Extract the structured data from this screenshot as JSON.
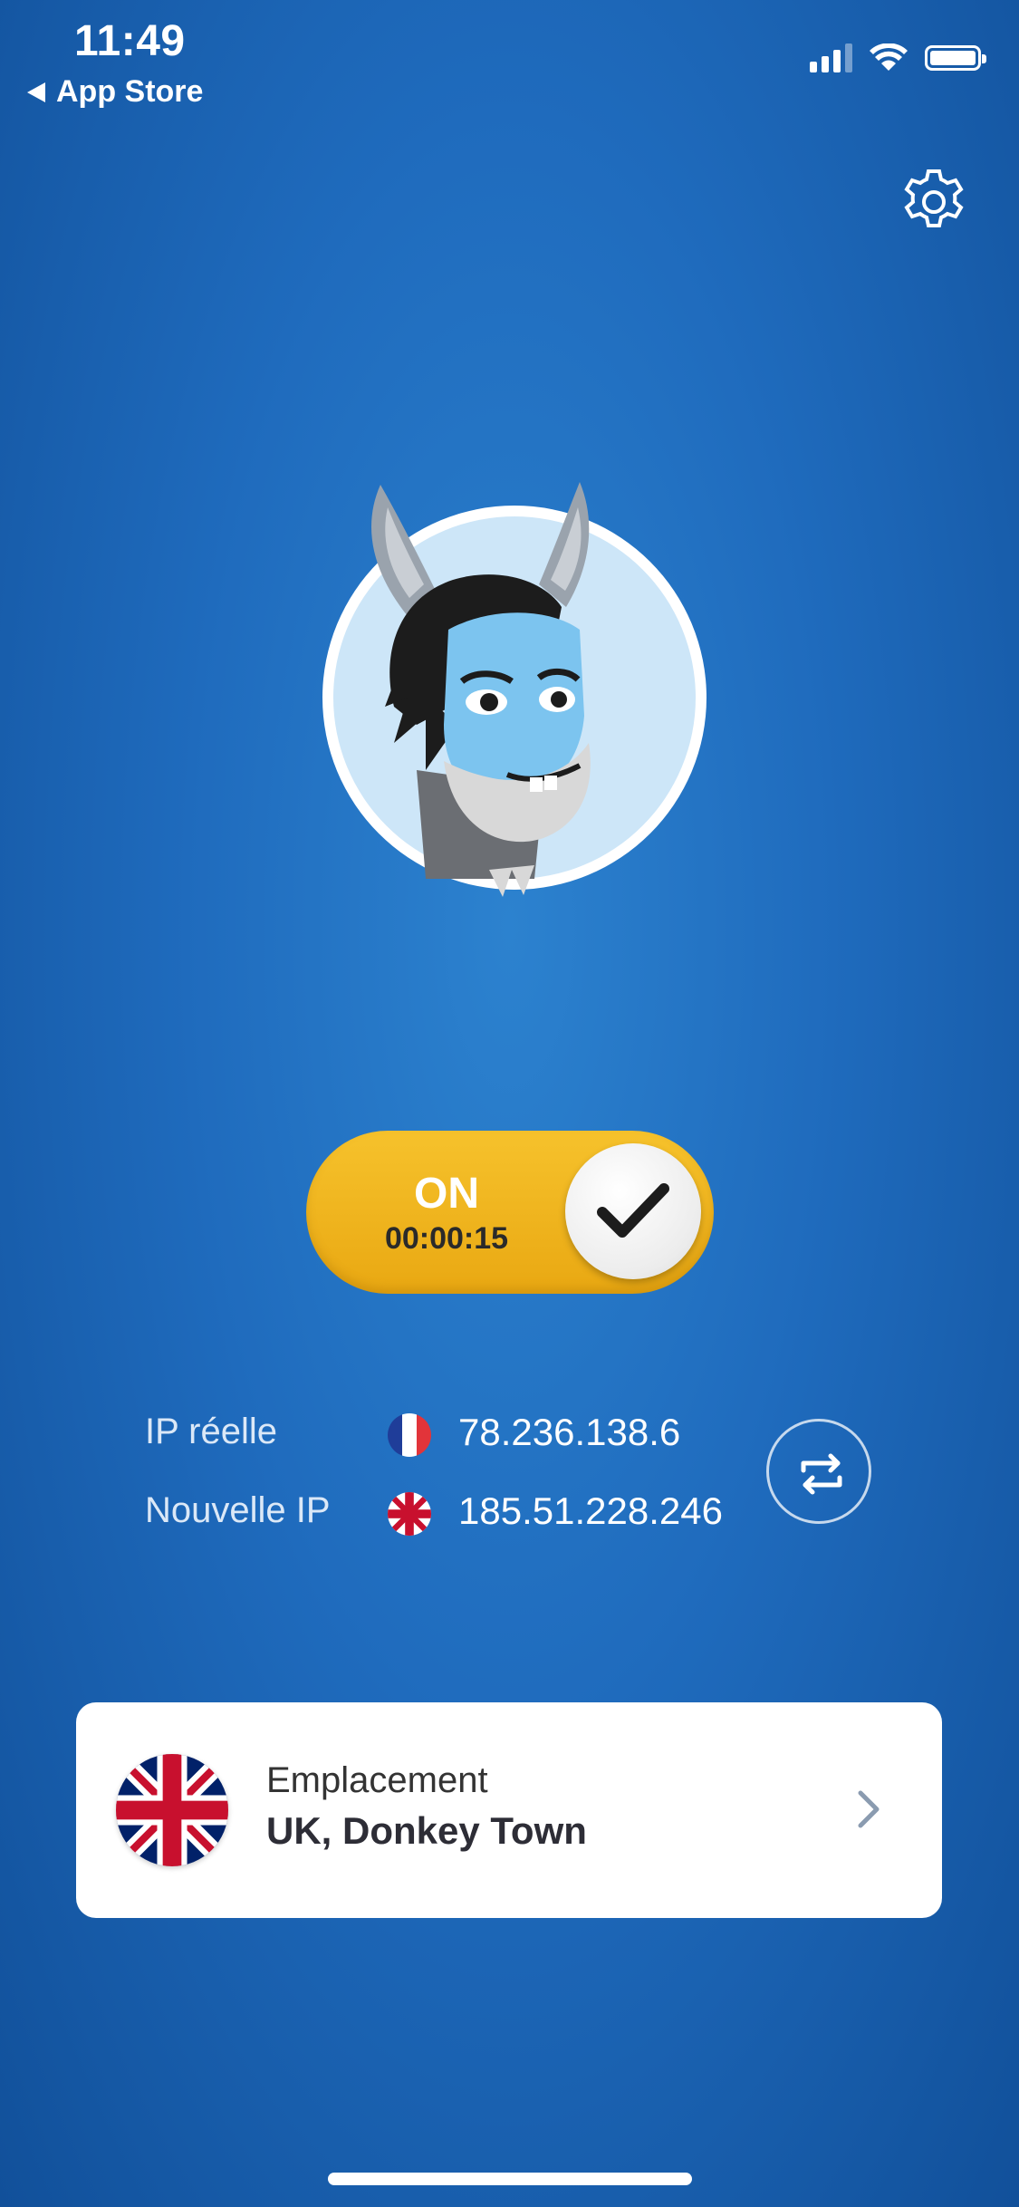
{
  "status_bar": {
    "time": "11:49",
    "back_label": "App Store"
  },
  "settings": {
    "icon": "gear-icon"
  },
  "avatar": {
    "icon": "donkey-mascot-icon"
  },
  "toggle": {
    "state_label": "ON",
    "timer": "00:00:15",
    "icon": "checkmark-icon"
  },
  "ip": {
    "real_label": "IP réelle",
    "real_value": "78.236.138.6",
    "real_flag": "france-flag-icon",
    "new_label": "Nouvelle IP",
    "new_value": "185.51.228.246",
    "new_flag": "uk-flag-icon",
    "swap_icon": "swap-icon"
  },
  "location": {
    "label": "Emplacement",
    "value": "UK, Donkey Town",
    "flag": "uk-flag-icon"
  },
  "colors": {
    "background": "#1f6bbd",
    "toggle": "#f2b822",
    "card": "#ffffff"
  }
}
